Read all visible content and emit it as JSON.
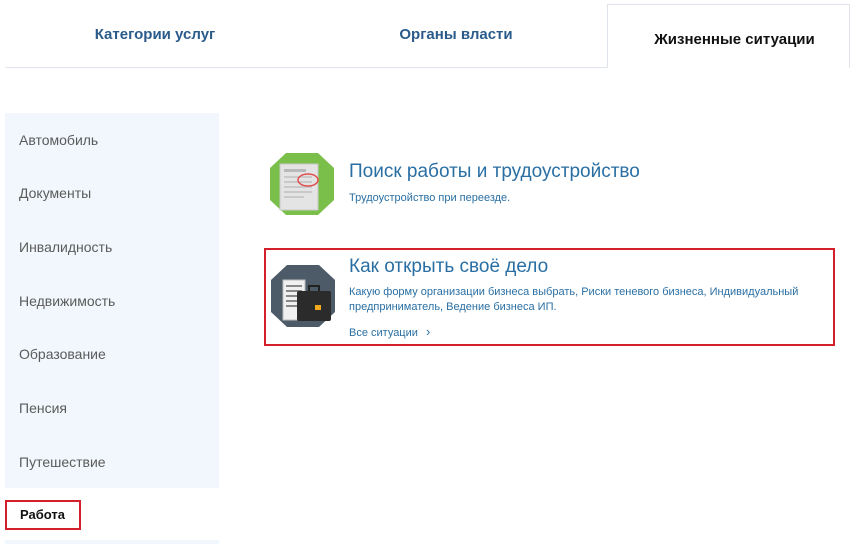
{
  "tabs": [
    {
      "label": "Категории услуг",
      "active": false
    },
    {
      "label": "Органы власти",
      "active": false
    },
    {
      "label": "Жизненные ситуации",
      "active": true
    }
  ],
  "sidebar": {
    "items": [
      {
        "label": "Автомобиль"
      },
      {
        "label": "Документы"
      },
      {
        "label": "Инвалидность"
      },
      {
        "label": "Недвижимость"
      },
      {
        "label": "Образование"
      },
      {
        "label": "Пенсия"
      },
      {
        "label": "Путешествие"
      },
      {
        "label": "Работа",
        "active": true
      }
    ]
  },
  "main": {
    "blocks": [
      {
        "icon": "document-icon",
        "title": "Поиск работы и трудоустройство",
        "description": "Трудоустройство при переезде."
      },
      {
        "icon": "briefcase-icon",
        "title": "Как открыть своё дело",
        "description_line1": "Какую форму организации бизнеса выбрать, Риски теневого бизнеса, Индивидуальный",
        "description_line2": "предприниматель, Ведение бизнеса ИП.",
        "link": "Все ситуации",
        "link_arrow": "›"
      }
    ]
  },
  "colors": {
    "accent": "#2a6fa3",
    "highlight": "#d4202a",
    "sidebar_bg": "#f1f7fc"
  }
}
